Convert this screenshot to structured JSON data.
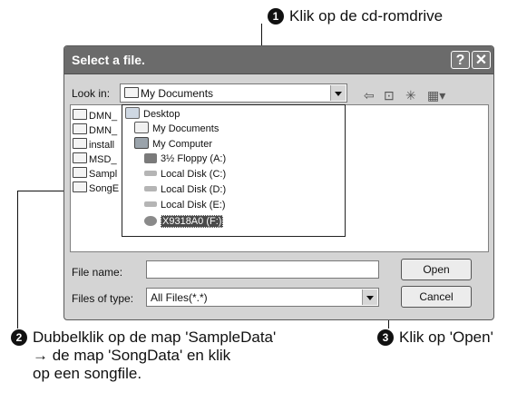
{
  "callouts": {
    "c1": {
      "num": "1",
      "text": "Klik op de cd-romdrive"
    },
    "c2": {
      "num": "2",
      "line1": "Dubbelklik op de map 'SampleData'",
      "line2": "→ de map 'SongData' en klik",
      "line3": "op een songfile."
    },
    "c3": {
      "num": "3",
      "text": "Klik op 'Open'"
    }
  },
  "dialog": {
    "title": "Select a file.",
    "help_label": "?",
    "close_label": "✕",
    "look_in_label": "Look in:",
    "look_in_value": "My Documents",
    "toolbar_icons": [
      "back-icon",
      "up-folder-icon",
      "new-folder-icon",
      "view-menu-icon"
    ],
    "folders": [
      "DMN_",
      "DMN_",
      "install",
      "MSD_",
      "Sampl",
      "SongE"
    ],
    "dropdown": {
      "items": [
        {
          "label": "Desktop",
          "icon": "desktop-icon",
          "indent": 0
        },
        {
          "label": "My Documents",
          "icon": "documents-icon",
          "indent": 1
        },
        {
          "label": "My Computer",
          "icon": "computer-icon",
          "indent": 1
        },
        {
          "label": "3½ Floppy (A:)",
          "icon": "floppy-icon",
          "indent": 2
        },
        {
          "label": "Local Disk (C:)",
          "icon": "disk-icon",
          "indent": 2
        },
        {
          "label": "Local Disk (D:)",
          "icon": "disk-icon",
          "indent": 2
        },
        {
          "label": "Local Disk (E:)",
          "icon": "disk-icon",
          "indent": 2
        },
        {
          "label": "X9318A0 (F:)",
          "icon": "cdrom-icon",
          "indent": 2,
          "selected": true
        }
      ]
    },
    "file_name_label": "File name:",
    "file_name_value": "",
    "files_of_type_label": "Files of type:",
    "files_of_type_value": "All Files(*.*)",
    "open_label": "Open",
    "cancel_label": "Cancel"
  }
}
